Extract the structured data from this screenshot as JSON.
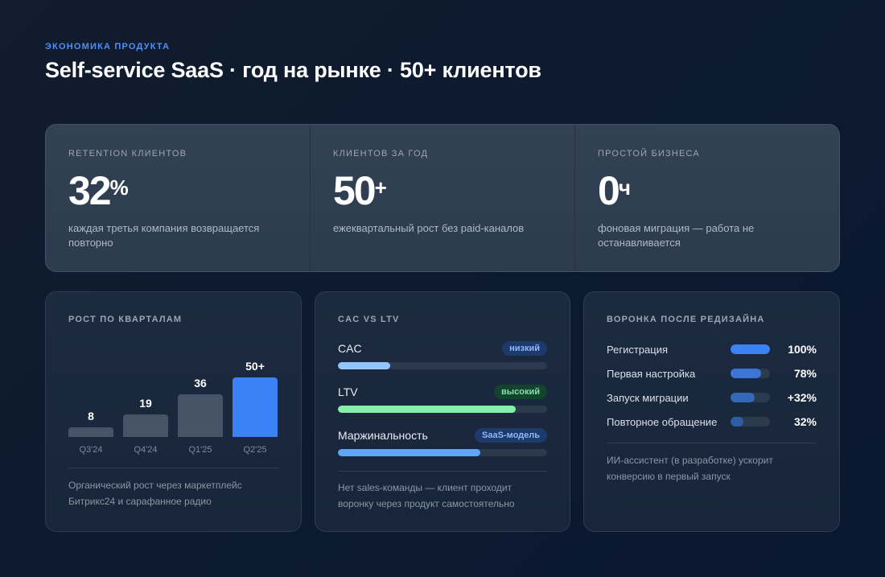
{
  "header": {
    "eyebrow": "ЭКОНОМИКА ПРОДУКТА",
    "title": "Self-service SaaS · год на рынке · 50+ клиентов"
  },
  "kpis": [
    {
      "label": "RETENTION КЛИЕНТОВ",
      "value": "32",
      "suffix": "%",
      "desc": "каждая третья компания возвращается повторно"
    },
    {
      "label": "КЛИЕНТОВ ЗА ГОД",
      "value": "50",
      "suffix": "+",
      "desc": "ежеквартальный рост без paid-каналов"
    },
    {
      "label": "ПРОСТОЙ БИЗНЕСА",
      "value": "0",
      "suffix": "ч",
      "desc": "фоновая миграция — работа не останавливается"
    }
  ],
  "growth": {
    "title": "РОСТ ПО КВАРТАЛАМ",
    "footnote": "Органический рост через маркетплейс Битрикс24 и сарафанное радио"
  },
  "chart_data": {
    "type": "bar",
    "categories": [
      "Q3'24",
      "Q4'24",
      "Q1'25",
      "Q2'25"
    ],
    "values": [
      8,
      19,
      36,
      50
    ],
    "value_labels": [
      "8",
      "19",
      "36",
      "50+"
    ],
    "highlight_index": 3,
    "colors": {
      "default": "#475467",
      "highlight": "#3b82f6"
    }
  },
  "cac_ltv": {
    "title": "CAC VS LTV",
    "metrics": [
      {
        "name": "CAC",
        "badge": "низкий",
        "level": 0.25,
        "color": "#93c5fd",
        "badge_style": "low"
      },
      {
        "name": "LTV",
        "badge": "высокий",
        "level": 0.85,
        "color": "#86efac",
        "badge_style": "high"
      },
      {
        "name": "Маржинальность",
        "badge": "SaaS-модель",
        "level": 0.68,
        "color": "#60a5fa",
        "badge_style": "saas"
      }
    ],
    "footnote": "Нет sales-команды — клиент проходит воронку через продукт самостоятельно"
  },
  "funnel": {
    "title": "ВОРОНКА ПОСЛЕ РЕДИЗАЙНА",
    "steps": [
      {
        "name": "Регистрация",
        "value": "100%",
        "level": 1.0,
        "color": "#3b82f6"
      },
      {
        "name": "Первая настройка",
        "value": "78%",
        "level": 0.78,
        "color": "#3b76d6"
      },
      {
        "name": "Запуск миграции",
        "value": "+32%",
        "level": 0.62,
        "color": "#3568b8"
      },
      {
        "name": "Повторное обращение",
        "value": "32%",
        "level": 0.32,
        "color": "#2f5da3"
      }
    ],
    "footnote": "ИИ-ассистент (в разработке) ускорит конверсию в первый запуск"
  }
}
